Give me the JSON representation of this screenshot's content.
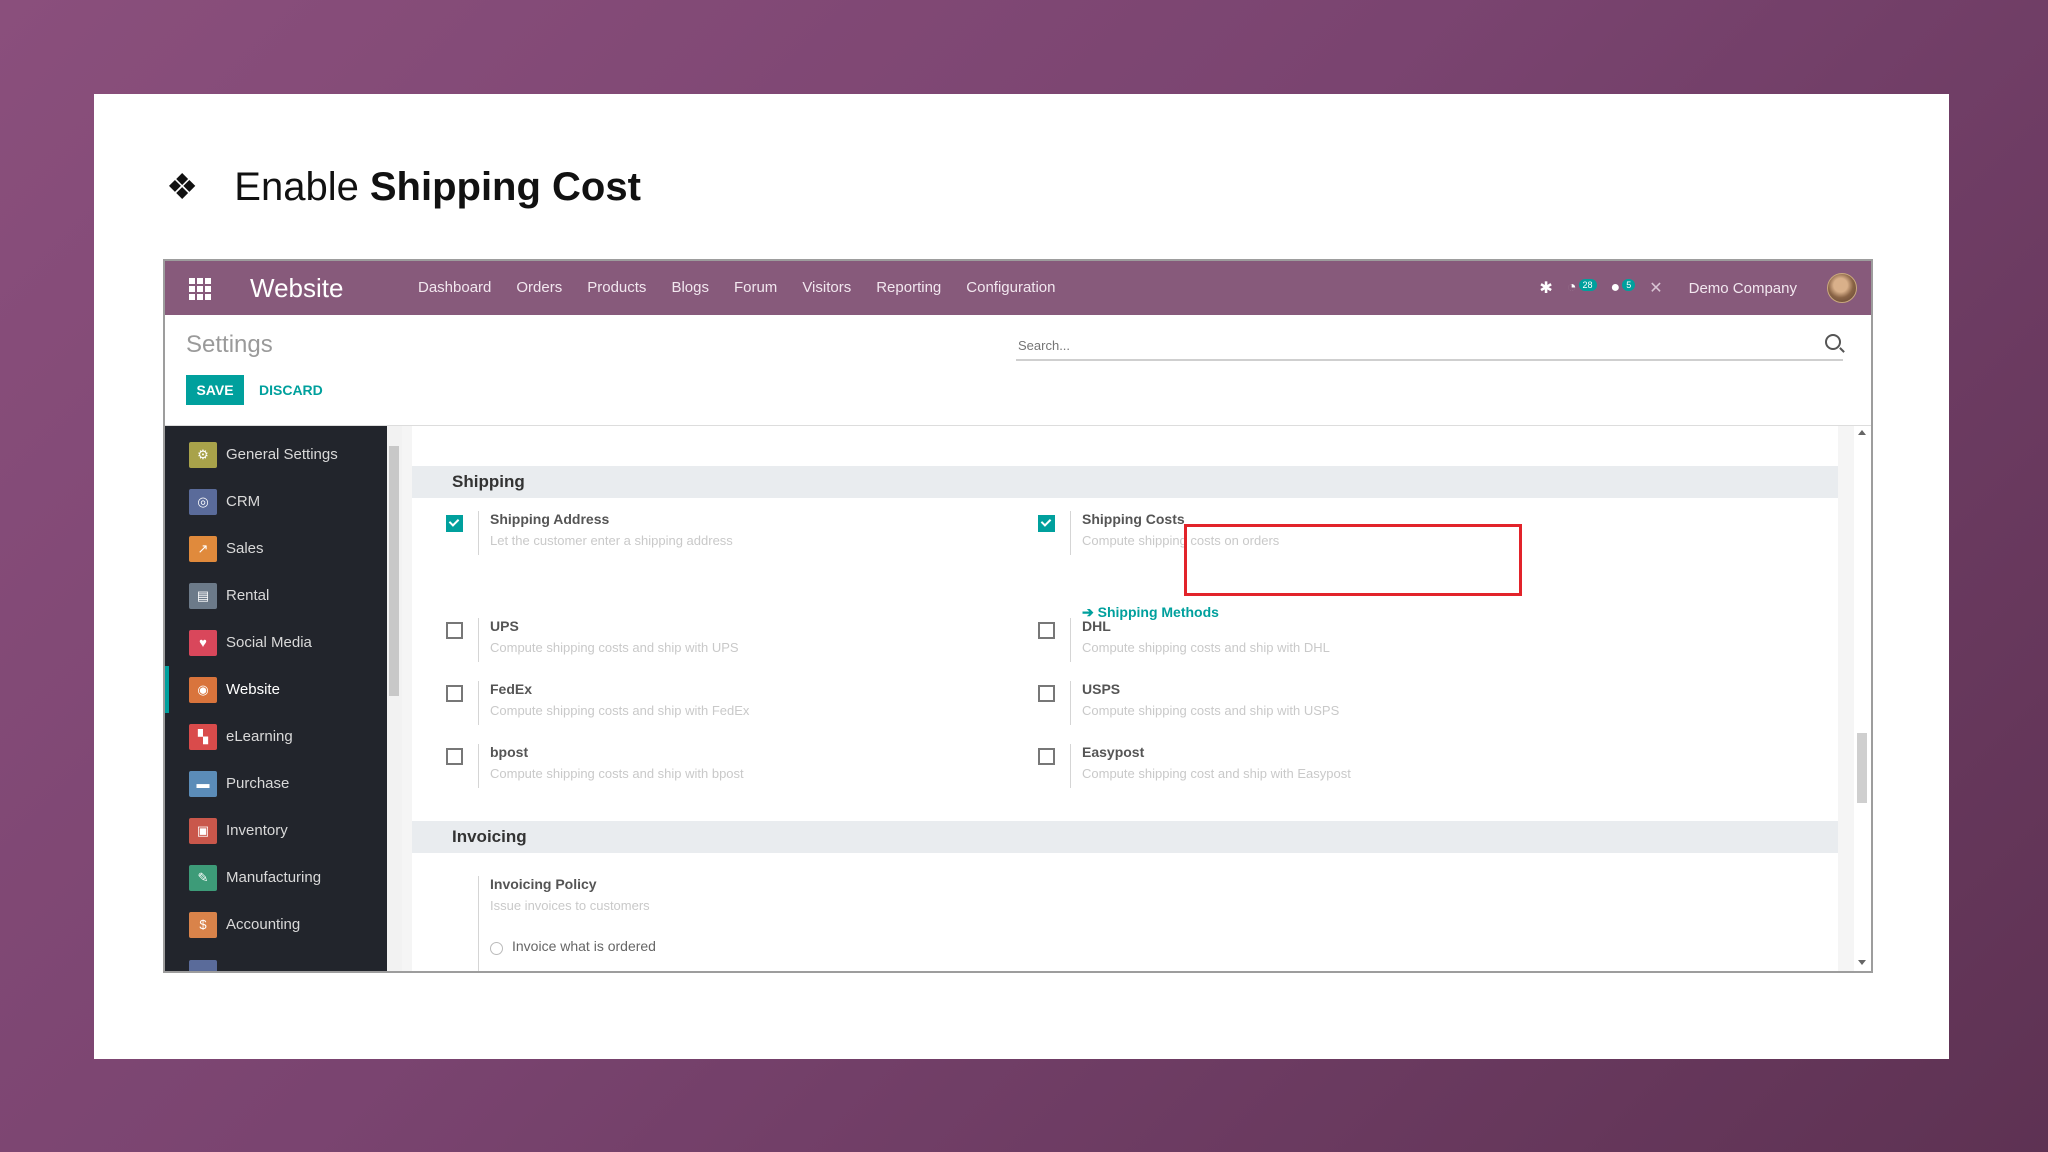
{
  "slide": {
    "bullet": "❖",
    "title_prefix": "Enable",
    "title_bold": "Shipping Cost"
  },
  "navbar": {
    "brand": "Website",
    "menu": [
      "Dashboard",
      "Orders",
      "Products",
      "Blogs",
      "Forum",
      "Visitors",
      "Reporting",
      "Configuration"
    ],
    "activity_badge": "28",
    "messages_badge": "5",
    "company": "Demo Company",
    "color": "#875a7b"
  },
  "control_panel": {
    "title": "Settings",
    "save_label": "SAVE",
    "discard_label": "DISCARD",
    "search_placeholder": "Search..."
  },
  "sidebar": {
    "items": [
      {
        "label": "General Settings",
        "icon": "gear-icon",
        "color": "#a8a24a"
      },
      {
        "label": "CRM",
        "icon": "crm-icon",
        "color": "#5a6b9a"
      },
      {
        "label": "Sales",
        "icon": "sales-chart-icon",
        "color": "#e08a3c"
      },
      {
        "label": "Rental",
        "icon": "rental-icon",
        "color": "#6c7a89"
      },
      {
        "label": "Social Media",
        "icon": "thumbs-up-icon",
        "color": "#d9475b"
      },
      {
        "label": "Website",
        "icon": "globe-icon",
        "color": "#d9743c"
      },
      {
        "label": "eLearning",
        "icon": "elearning-icon",
        "color": "#d94b4b"
      },
      {
        "label": "Purchase",
        "icon": "purchase-icon",
        "color": "#5b8cb8"
      },
      {
        "label": "Inventory",
        "icon": "inventory-box-icon",
        "color": "#c9574b"
      },
      {
        "label": "Manufacturing",
        "icon": "wrench-icon",
        "color": "#3d9b78"
      },
      {
        "label": "Accounting",
        "icon": "accounting-icon",
        "color": "#d9834a"
      }
    ],
    "active_index": 5
  },
  "shipping": {
    "header": "Shipping",
    "settings": [
      {
        "title": "Shipping Address",
        "desc": "Let the customer enter a shipping address",
        "checked": true
      },
      {
        "title": "Shipping Costs",
        "desc": "Compute shipping costs on orders",
        "checked": true
      },
      {
        "title": "UPS",
        "desc": "Compute shipping costs and ship with UPS",
        "checked": false
      },
      {
        "title": "DHL",
        "desc": "Compute shipping costs and ship with DHL",
        "checked": false
      },
      {
        "title": "FedEx",
        "desc": "Compute shipping costs and ship with FedEx",
        "checked": false
      },
      {
        "title": "USPS",
        "desc": "Compute shipping costs and ship with USPS",
        "checked": false
      },
      {
        "title": "bpost",
        "desc": "Compute shipping costs and ship with bpost",
        "checked": false
      },
      {
        "title": "Easypost",
        "desc": "Compute shipping cost and ship with Easypost",
        "checked": false
      }
    ],
    "shipping_methods_link": "Shipping Methods",
    "highlight_color": "#e2232a"
  },
  "invoicing": {
    "header": "Invoicing",
    "policy_title": "Invoicing Policy",
    "policy_desc": "Issue invoices to customers",
    "option": "Invoice what is ordered"
  }
}
